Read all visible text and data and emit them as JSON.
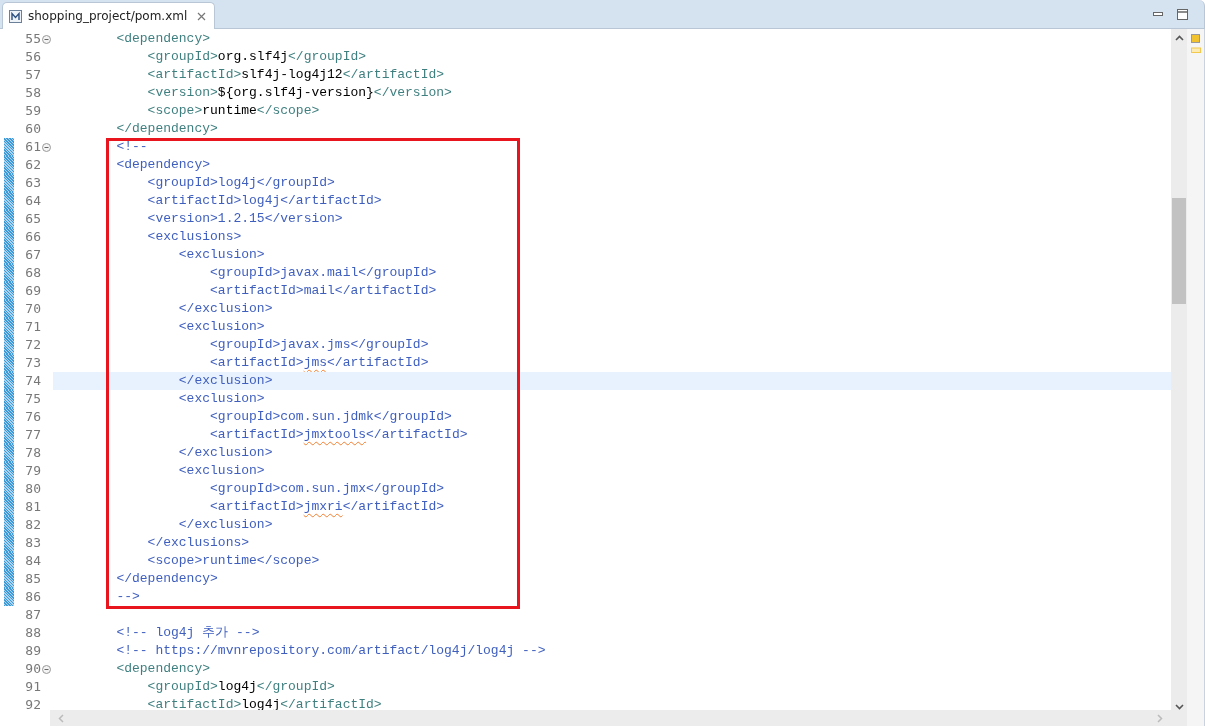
{
  "tab": {
    "title": "shopping_project/pom.xml",
    "selected": true
  },
  "blocks": [
    {
      "boxed": false,
      "lines": [
        {
          "number": "55",
          "fold": true,
          "changed": false,
          "current": false,
          "segments": [
            {
              "kind": "tag",
              "text": "        <dependency>"
            }
          ]
        },
        {
          "number": "56",
          "fold": false,
          "changed": false,
          "current": false,
          "segments": [
            {
              "kind": "tag",
              "text": "            <groupId>"
            },
            {
              "kind": "text",
              "text": "org.slf4j"
            },
            {
              "kind": "tag",
              "text": "</groupId>"
            }
          ]
        },
        {
          "number": "57",
          "fold": false,
          "changed": false,
          "current": false,
          "segments": [
            {
              "kind": "tag",
              "text": "            <artifactId>"
            },
            {
              "kind": "text",
              "text": "slf4j-log4j12"
            },
            {
              "kind": "tag",
              "text": "</artifactId>"
            }
          ]
        },
        {
          "number": "58",
          "fold": false,
          "changed": false,
          "current": false,
          "segments": [
            {
              "kind": "tag",
              "text": "            <version>"
            },
            {
              "kind": "text",
              "text": "${org.slf4j-version}"
            },
            {
              "kind": "tag",
              "text": "</version>"
            }
          ]
        },
        {
          "number": "59",
          "fold": false,
          "changed": false,
          "current": false,
          "segments": [
            {
              "kind": "tag",
              "text": "            <scope>"
            },
            {
              "kind": "text",
              "text": "runtime"
            },
            {
              "kind": "tag",
              "text": "</scope>"
            }
          ]
        },
        {
          "number": "60",
          "fold": false,
          "changed": false,
          "current": false,
          "segments": [
            {
              "kind": "tag",
              "text": "        </dependency>"
            }
          ]
        }
      ]
    },
    {
      "boxed": true,
      "lines": [
        {
          "number": "61",
          "fold": true,
          "changed": true,
          "current": false,
          "segments": [
            {
              "kind": "comment",
              "text": "        <!--"
            }
          ]
        },
        {
          "number": "62",
          "fold": false,
          "changed": true,
          "current": false,
          "segments": [
            {
              "kind": "comment",
              "text": "        <dependency>"
            }
          ]
        },
        {
          "number": "63",
          "fold": false,
          "changed": true,
          "current": false,
          "segments": [
            {
              "kind": "comment",
              "text": "            <groupId>log4j</groupId>"
            }
          ]
        },
        {
          "number": "64",
          "fold": false,
          "changed": true,
          "current": false,
          "segments": [
            {
              "kind": "comment",
              "text": "            <artifactId>log4j</artifactId>"
            }
          ]
        },
        {
          "number": "65",
          "fold": false,
          "changed": true,
          "current": false,
          "segments": [
            {
              "kind": "comment",
              "text": "            <version>1.2.15</version>"
            }
          ]
        },
        {
          "number": "66",
          "fold": false,
          "changed": true,
          "current": false,
          "segments": [
            {
              "kind": "comment",
              "text": "            <exclusions>"
            }
          ]
        },
        {
          "number": "67",
          "fold": false,
          "changed": true,
          "current": false,
          "segments": [
            {
              "kind": "comment",
              "text": "                <exclusion>"
            }
          ]
        },
        {
          "number": "68",
          "fold": false,
          "changed": true,
          "current": false,
          "segments": [
            {
              "kind": "comment",
              "text": "                    <groupId>javax.mail</groupId>"
            }
          ]
        },
        {
          "number": "69",
          "fold": false,
          "changed": true,
          "current": false,
          "segments": [
            {
              "kind": "comment",
              "text": "                    <artifactId>mail</artifactId>"
            }
          ]
        },
        {
          "number": "70",
          "fold": false,
          "changed": true,
          "current": false,
          "segments": [
            {
              "kind": "comment",
              "text": "                </exclusion>"
            }
          ]
        },
        {
          "number": "71",
          "fold": false,
          "changed": true,
          "current": false,
          "segments": [
            {
              "kind": "comment",
              "text": "                <exclusion>"
            }
          ]
        },
        {
          "number": "72",
          "fold": false,
          "changed": true,
          "current": false,
          "segments": [
            {
              "kind": "comment",
              "text": "                    <groupId>javax.jms</groupId>"
            }
          ]
        },
        {
          "number": "73",
          "fold": false,
          "changed": true,
          "current": false,
          "segments": [
            {
              "kind": "comment",
              "text": "                    <artifactId>"
            },
            {
              "kind": "misspelled",
              "text": "jms"
            },
            {
              "kind": "comment",
              "text": "</artifactId>"
            }
          ]
        },
        {
          "number": "74",
          "fold": false,
          "changed": true,
          "current": true,
          "segments": [
            {
              "kind": "comment",
              "text": "                </exclusion>"
            }
          ]
        },
        {
          "number": "75",
          "fold": false,
          "changed": true,
          "current": false,
          "segments": [
            {
              "kind": "comment",
              "text": "                <exclusion>"
            }
          ]
        },
        {
          "number": "76",
          "fold": false,
          "changed": true,
          "current": false,
          "segments": [
            {
              "kind": "comment",
              "text": "                    <groupId>com.sun.jdmk</groupId>"
            }
          ]
        },
        {
          "number": "77",
          "fold": false,
          "changed": true,
          "current": false,
          "segments": [
            {
              "kind": "comment",
              "text": "                    <artifactId>"
            },
            {
              "kind": "misspelled",
              "text": "jmxtools"
            },
            {
              "kind": "comment",
              "text": "</artifactId>"
            }
          ]
        },
        {
          "number": "78",
          "fold": false,
          "changed": true,
          "current": false,
          "segments": [
            {
              "kind": "comment",
              "text": "                </exclusion>"
            }
          ]
        },
        {
          "number": "79",
          "fold": false,
          "changed": true,
          "current": false,
          "segments": [
            {
              "kind": "comment",
              "text": "                <exclusion>"
            }
          ]
        },
        {
          "number": "80",
          "fold": false,
          "changed": true,
          "current": false,
          "segments": [
            {
              "kind": "comment",
              "text": "                    <groupId>com.sun.jmx</groupId>"
            }
          ]
        },
        {
          "number": "81",
          "fold": false,
          "changed": true,
          "current": false,
          "segments": [
            {
              "kind": "comment",
              "text": "                    <artifactId>"
            },
            {
              "kind": "misspelled",
              "text": "jmxri"
            },
            {
              "kind": "comment",
              "text": "</artifactId>"
            }
          ]
        },
        {
          "number": "82",
          "fold": false,
          "changed": true,
          "current": false,
          "segments": [
            {
              "kind": "comment",
              "text": "                </exclusion>"
            }
          ]
        },
        {
          "number": "83",
          "fold": false,
          "changed": true,
          "current": false,
          "segments": [
            {
              "kind": "comment",
              "text": "            </exclusions>"
            }
          ]
        },
        {
          "number": "84",
          "fold": false,
          "changed": true,
          "current": false,
          "segments": [
            {
              "kind": "comment",
              "text": "            <scope>runtime</scope>"
            }
          ]
        },
        {
          "number": "85",
          "fold": false,
          "changed": true,
          "current": false,
          "segments": [
            {
              "kind": "comment",
              "text": "        </dependency>"
            }
          ]
        },
        {
          "number": "86",
          "fold": false,
          "changed": true,
          "current": false,
          "segments": [
            {
              "kind": "comment",
              "text": "        -->"
            }
          ]
        }
      ]
    },
    {
      "boxed": false,
      "lines": [
        {
          "number": "87",
          "fold": false,
          "changed": false,
          "current": false
        },
        {
          "number": "88",
          "fold": false,
          "changed": false,
          "current": false,
          "segments": [
            {
              "kind": "comment",
              "text": "        <!-- log4j 추가 -->"
            }
          ]
        },
        {
          "number": "89",
          "fold": false,
          "changed": false,
          "current": false,
          "segments": [
            {
              "kind": "comment",
              "text": "        <!-- https://mvnrepository.com/artifact/log4j/log4j -->"
            }
          ]
        },
        {
          "number": "90",
          "fold": true,
          "changed": false,
          "current": false,
          "segments": [
            {
              "kind": "tag",
              "text": "        <dependency>"
            }
          ]
        },
        {
          "number": "91",
          "fold": false,
          "changed": false,
          "current": false,
          "segments": [
            {
              "kind": "tag",
              "text": "            <groupId>"
            },
            {
              "kind": "text",
              "text": "log4j"
            },
            {
              "kind": "tag",
              "text": "</groupId>"
            }
          ]
        },
        {
          "number": "92",
          "fold": false,
          "changed": false,
          "current": false,
          "segments": [
            {
              "kind": "tag",
              "text": "            <artifactId>"
            },
            {
              "kind": "text",
              "text": "log4j"
            },
            {
              "kind": "tag",
              "text": "</artifactId>"
            }
          ]
        }
      ]
    }
  ]
}
